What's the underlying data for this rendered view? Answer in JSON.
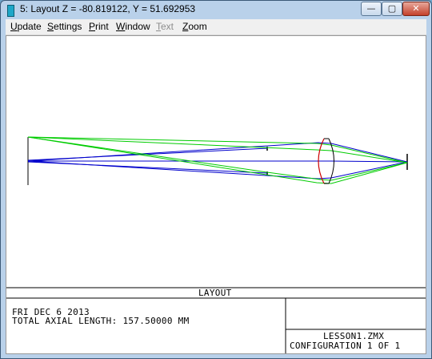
{
  "window": {
    "title": "5: Layout Z = -80.819122, Y = 51.692953",
    "min_glyph": "—",
    "max_glyph": "▢",
    "close_glyph": "✕"
  },
  "menu": {
    "items": [
      {
        "label": "Update",
        "underline": "U",
        "rest": "pdate",
        "enabled": true
      },
      {
        "label": "Settings",
        "underline": "S",
        "rest": "ettings",
        "enabled": true
      },
      {
        "label": "Print",
        "underline": "P",
        "rest": "rint",
        "enabled": true
      },
      {
        "label": "Window",
        "underline": "W",
        "rest": "indow",
        "enabled": true
      },
      {
        "label": "Text",
        "underline": "T",
        "rest": "ext",
        "enabled": false
      },
      {
        "label": "Zoom",
        "underline": "Z",
        "rest": "oom",
        "enabled": true
      }
    ]
  },
  "plot": {
    "colors": {
      "field_1": "#0000cc",
      "field_2": "#00cc00",
      "lens_front": "#cc0000",
      "lens_body": "#000000"
    }
  },
  "footer": {
    "caption": "LAYOUT",
    "date": "FRI DEC 6 2013",
    "total_length": "TOTAL AXIAL LENGTH:  157.50000 MM",
    "file": "LESSON1.ZMX",
    "configuration": "CONFIGURATION 1 OF 1"
  }
}
